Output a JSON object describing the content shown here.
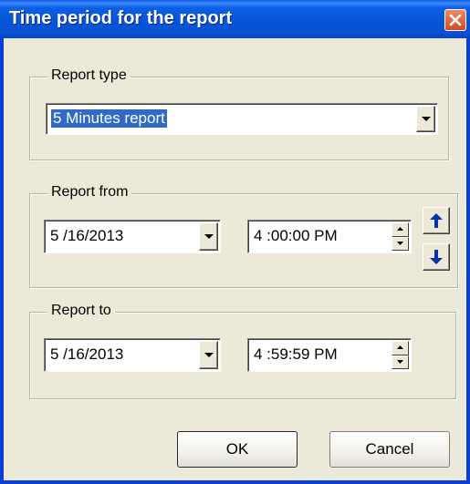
{
  "window": {
    "title": "Time period for the report",
    "close_icon": "close-icon"
  },
  "report_type": {
    "label": "Report type",
    "selected_value": "5 Minutes report"
  },
  "report_from": {
    "label": "Report from",
    "date": "5 /16/2013",
    "time": "4 :00:00 PM",
    "shift_up_icon": "arrow-up-icon",
    "shift_down_icon": "arrow-down-icon"
  },
  "report_to": {
    "label": "Report to",
    "date": "5 /16/2013",
    "time": "4 :59:59 PM"
  },
  "buttons": {
    "ok": "OK",
    "cancel": "Cancel"
  },
  "colors": {
    "titlebar": "#0654d9",
    "dialog_bg": "#ece9d8",
    "selection": "#316ac5",
    "arrow_blue": "#0b2fa8"
  }
}
